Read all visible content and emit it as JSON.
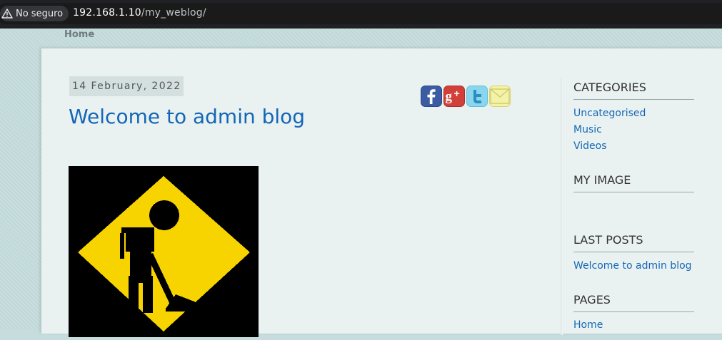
{
  "browser": {
    "security_label": "No seguro",
    "url_host": "192.168.1.10",
    "url_path": "/my_weblog/"
  },
  "nav": {
    "home": "Home"
  },
  "post": {
    "date": "14 February, 2022",
    "title": "Welcome to admin blog",
    "share_icons": [
      "facebook-icon",
      "google-plus-icon",
      "twitter-icon",
      "email-icon"
    ],
    "image_name": "under-construction-sign"
  },
  "sidebar": {
    "categories_title": "CATEGORIES",
    "categories": [
      "Uncategorised",
      "Music",
      "Videos"
    ],
    "my_image_title": "MY IMAGE",
    "last_posts_title": "LAST POSTS",
    "last_posts": [
      "Welcome to admin blog"
    ],
    "pages_title": "PAGES",
    "pages": [
      "Home"
    ]
  },
  "colors": {
    "link": "#1467b7",
    "page_bg": "#c5dcdd",
    "card_bg": "#eaf2f1",
    "sign_yellow": "#f7d400"
  }
}
